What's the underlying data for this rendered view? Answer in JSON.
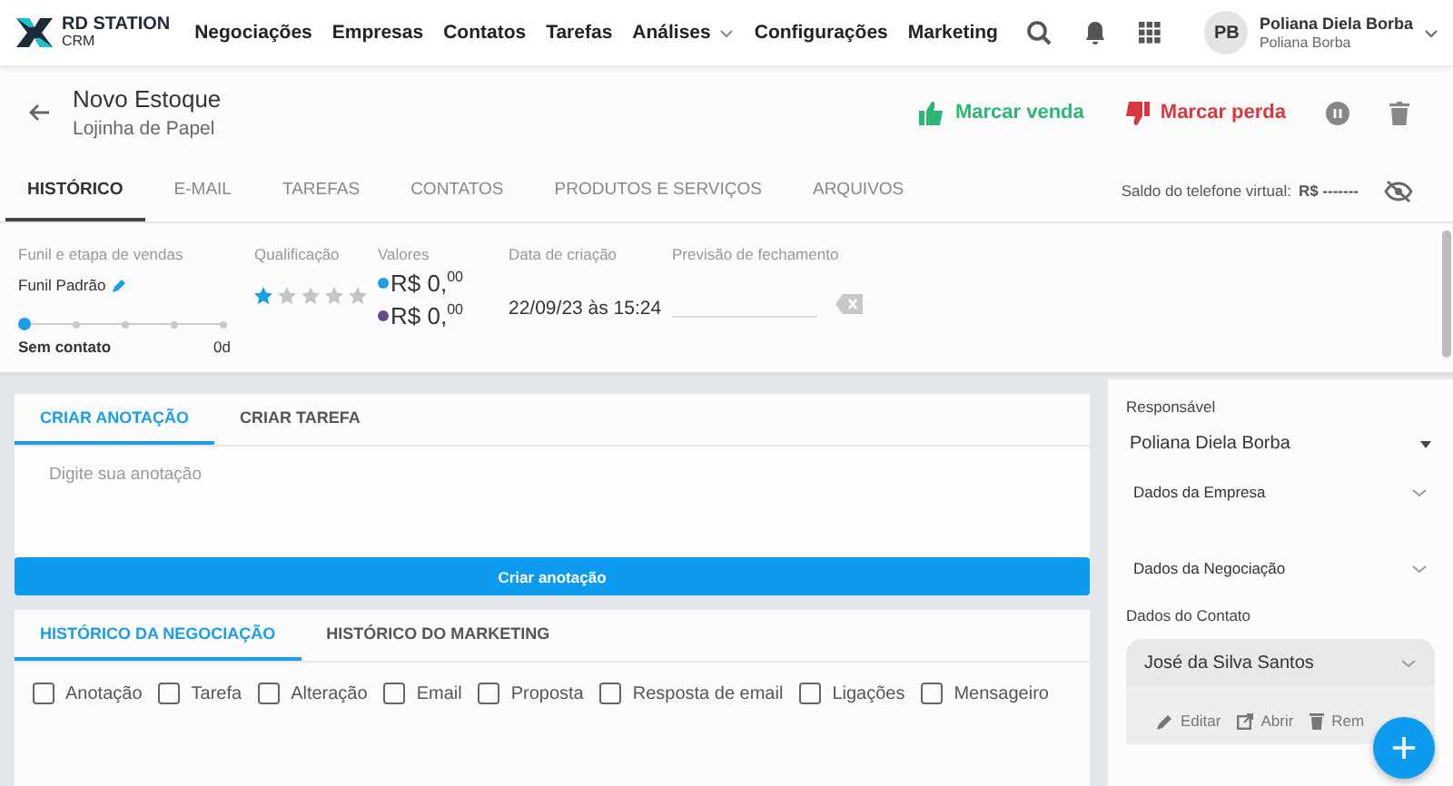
{
  "nav": {
    "logo": "RD STATION",
    "logo_sub": "CRM",
    "items": [
      {
        "label": "Negociações",
        "dropdown": false
      },
      {
        "label": "Empresas",
        "dropdown": false
      },
      {
        "label": "Contatos",
        "dropdown": false
      },
      {
        "label": "Tarefas",
        "dropdown": false
      },
      {
        "label": "Análises",
        "dropdown": true
      },
      {
        "label": "Configurações",
        "dropdown": false
      },
      {
        "label": "Marketing",
        "dropdown": false
      }
    ],
    "user": {
      "initials": "PB",
      "name": "Poliana Diela Borba",
      "sub": "Poliana Borba"
    }
  },
  "deal": {
    "title": "Novo Estoque",
    "subtitle": "Lojinha de Papel",
    "win": "Marcar venda",
    "loss": "Marcar perda"
  },
  "tabs": [
    {
      "label": "HISTÓRICO",
      "selected": true
    },
    {
      "label": "E-MAIL",
      "selected": false
    },
    {
      "label": "TAREFAS",
      "selected": false
    },
    {
      "label": "CONTATOS",
      "selected": false
    },
    {
      "label": "PRODUTOS E SERVIÇOS",
      "selected": false
    },
    {
      "label": "ARQUIVOS",
      "selected": false
    }
  ],
  "balance": {
    "label": "Saldo do telefone virtual:",
    "value": "R$ -------"
  },
  "info": {
    "funnel_label": "Funil e etapa de vendas",
    "funnel": "Funil Padrão",
    "stages": [
      {
        "selected": true
      },
      {
        "selected": false
      },
      {
        "selected": false
      },
      {
        "selected": false
      },
      {
        "selected": false
      }
    ],
    "stage_name": "Sem contato",
    "stage_days": "0d",
    "qual_label": "Qualificação",
    "stars": 1,
    "values_label": "Valores",
    "values": [
      {
        "main": "R$ 0,",
        "cents": "00",
        "color": "#1a9ee8"
      },
      {
        "main": "R$ 0,",
        "cents": "00",
        "color": "#6a4a8c"
      }
    ],
    "created_label": "Data de criação",
    "created": "22/09/23 às 15:24",
    "forecast_label": "Previsão de fechamento"
  },
  "note_tabs": [
    {
      "label": "CRIAR ANOTAÇÃO",
      "selected": true
    },
    {
      "label": "CRIAR TAREFA",
      "selected": false
    }
  ],
  "note": {
    "placeholder": "Digite sua anotação",
    "button": "Criar anotação"
  },
  "history_tabs": [
    {
      "label": "HISTÓRICO DA NEGOCIAÇÃO",
      "selected": true
    },
    {
      "label": "HISTÓRICO DO MARKETING",
      "selected": false
    }
  ],
  "filters": [
    {
      "label": "Anotação",
      "checked": false
    },
    {
      "label": "Tarefa",
      "checked": false
    },
    {
      "label": "Alteração",
      "checked": false
    },
    {
      "label": "Email",
      "checked": false
    },
    {
      "label": "Proposta",
      "checked": false
    },
    {
      "label": "Resposta de email",
      "checked": false
    },
    {
      "label": "Ligações",
      "checked": false
    },
    {
      "label": "Mensageiro",
      "checked": false
    }
  ],
  "side": {
    "owner_label": "Responsável",
    "owner": "Poliana Diela Borba",
    "sections": [
      {
        "label": "Dados da Empresa",
        "expanded": false
      },
      {
        "label": "Dados da Negociação",
        "expanded": false
      }
    ],
    "contact_label": "Dados do Contato",
    "contact": "José da Silva Santos",
    "actions": [
      "Editar",
      "Abrir",
      "Rem"
    ]
  }
}
